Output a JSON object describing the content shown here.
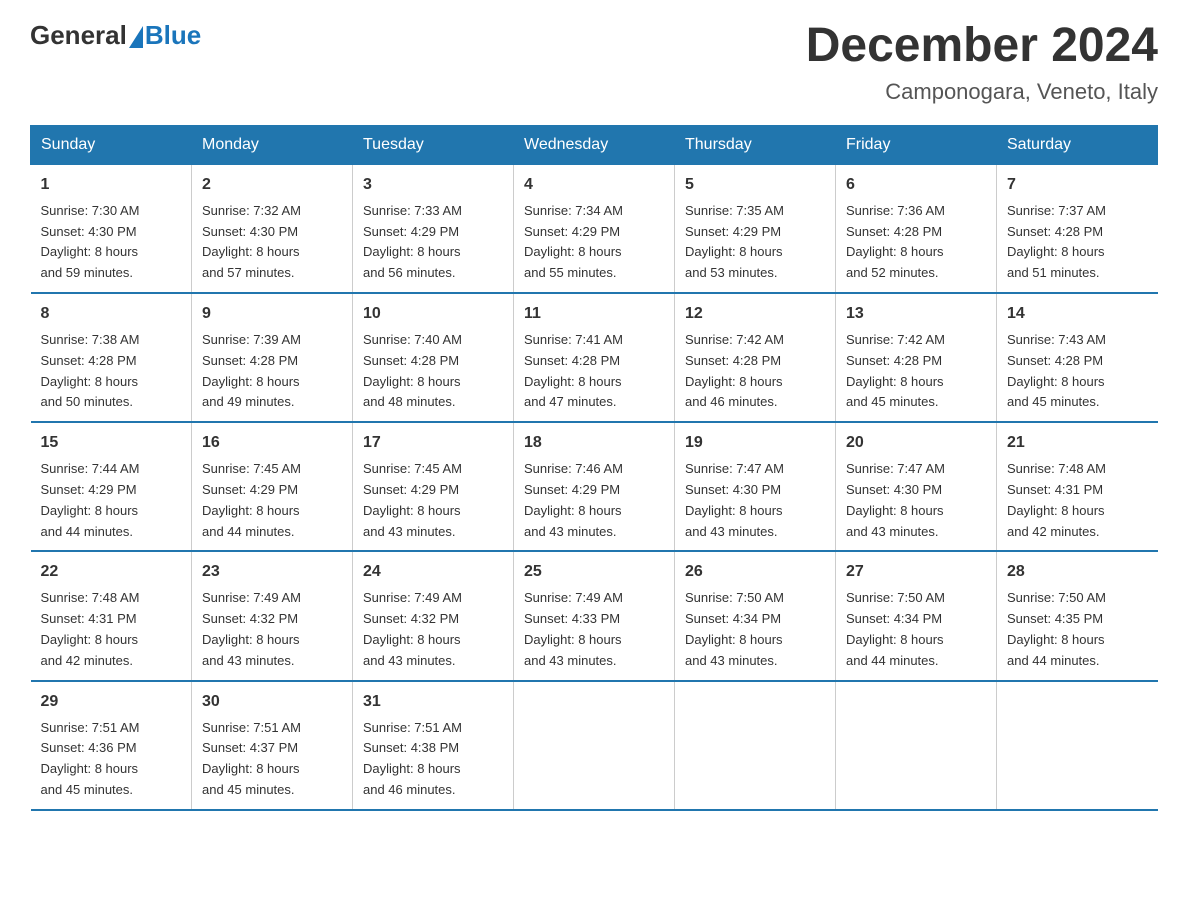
{
  "logo": {
    "general": "General",
    "blue": "Blue"
  },
  "title": "December 2024",
  "location": "Camponogara, Veneto, Italy",
  "days_of_week": [
    "Sunday",
    "Monday",
    "Tuesday",
    "Wednesday",
    "Thursday",
    "Friday",
    "Saturday"
  ],
  "weeks": [
    [
      {
        "day": "1",
        "sunrise": "7:30 AM",
        "sunset": "4:30 PM",
        "daylight": "8 hours and 59 minutes."
      },
      {
        "day": "2",
        "sunrise": "7:32 AM",
        "sunset": "4:30 PM",
        "daylight": "8 hours and 57 minutes."
      },
      {
        "day": "3",
        "sunrise": "7:33 AM",
        "sunset": "4:29 PM",
        "daylight": "8 hours and 56 minutes."
      },
      {
        "day": "4",
        "sunrise": "7:34 AM",
        "sunset": "4:29 PM",
        "daylight": "8 hours and 55 minutes."
      },
      {
        "day": "5",
        "sunrise": "7:35 AM",
        "sunset": "4:29 PM",
        "daylight": "8 hours and 53 minutes."
      },
      {
        "day": "6",
        "sunrise": "7:36 AM",
        "sunset": "4:28 PM",
        "daylight": "8 hours and 52 minutes."
      },
      {
        "day": "7",
        "sunrise": "7:37 AM",
        "sunset": "4:28 PM",
        "daylight": "8 hours and 51 minutes."
      }
    ],
    [
      {
        "day": "8",
        "sunrise": "7:38 AM",
        "sunset": "4:28 PM",
        "daylight": "8 hours and 50 minutes."
      },
      {
        "day": "9",
        "sunrise": "7:39 AM",
        "sunset": "4:28 PM",
        "daylight": "8 hours and 49 minutes."
      },
      {
        "day": "10",
        "sunrise": "7:40 AM",
        "sunset": "4:28 PM",
        "daylight": "8 hours and 48 minutes."
      },
      {
        "day": "11",
        "sunrise": "7:41 AM",
        "sunset": "4:28 PM",
        "daylight": "8 hours and 47 minutes."
      },
      {
        "day": "12",
        "sunrise": "7:42 AM",
        "sunset": "4:28 PM",
        "daylight": "8 hours and 46 minutes."
      },
      {
        "day": "13",
        "sunrise": "7:42 AM",
        "sunset": "4:28 PM",
        "daylight": "8 hours and 45 minutes."
      },
      {
        "day": "14",
        "sunrise": "7:43 AM",
        "sunset": "4:28 PM",
        "daylight": "8 hours and 45 minutes."
      }
    ],
    [
      {
        "day": "15",
        "sunrise": "7:44 AM",
        "sunset": "4:29 PM",
        "daylight": "8 hours and 44 minutes."
      },
      {
        "day": "16",
        "sunrise": "7:45 AM",
        "sunset": "4:29 PM",
        "daylight": "8 hours and 44 minutes."
      },
      {
        "day": "17",
        "sunrise": "7:45 AM",
        "sunset": "4:29 PM",
        "daylight": "8 hours and 43 minutes."
      },
      {
        "day": "18",
        "sunrise": "7:46 AM",
        "sunset": "4:29 PM",
        "daylight": "8 hours and 43 minutes."
      },
      {
        "day": "19",
        "sunrise": "7:47 AM",
        "sunset": "4:30 PM",
        "daylight": "8 hours and 43 minutes."
      },
      {
        "day": "20",
        "sunrise": "7:47 AM",
        "sunset": "4:30 PM",
        "daylight": "8 hours and 43 minutes."
      },
      {
        "day": "21",
        "sunrise": "7:48 AM",
        "sunset": "4:31 PM",
        "daylight": "8 hours and 42 minutes."
      }
    ],
    [
      {
        "day": "22",
        "sunrise": "7:48 AM",
        "sunset": "4:31 PM",
        "daylight": "8 hours and 42 minutes."
      },
      {
        "day": "23",
        "sunrise": "7:49 AM",
        "sunset": "4:32 PM",
        "daylight": "8 hours and 43 minutes."
      },
      {
        "day": "24",
        "sunrise": "7:49 AM",
        "sunset": "4:32 PM",
        "daylight": "8 hours and 43 minutes."
      },
      {
        "day": "25",
        "sunrise": "7:49 AM",
        "sunset": "4:33 PM",
        "daylight": "8 hours and 43 minutes."
      },
      {
        "day": "26",
        "sunrise": "7:50 AM",
        "sunset": "4:34 PM",
        "daylight": "8 hours and 43 minutes."
      },
      {
        "day": "27",
        "sunrise": "7:50 AM",
        "sunset": "4:34 PM",
        "daylight": "8 hours and 44 minutes."
      },
      {
        "day": "28",
        "sunrise": "7:50 AM",
        "sunset": "4:35 PM",
        "daylight": "8 hours and 44 minutes."
      }
    ],
    [
      {
        "day": "29",
        "sunrise": "7:51 AM",
        "sunset": "4:36 PM",
        "daylight": "8 hours and 45 minutes."
      },
      {
        "day": "30",
        "sunrise": "7:51 AM",
        "sunset": "4:37 PM",
        "daylight": "8 hours and 45 minutes."
      },
      {
        "day": "31",
        "sunrise": "7:51 AM",
        "sunset": "4:38 PM",
        "daylight": "8 hours and 46 minutes."
      },
      null,
      null,
      null,
      null
    ]
  ],
  "labels": {
    "sunrise": "Sunrise:",
    "sunset": "Sunset:",
    "daylight": "Daylight:"
  }
}
